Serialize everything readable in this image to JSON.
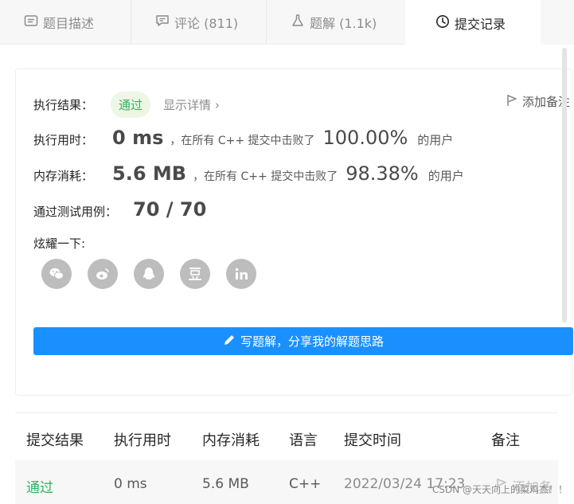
{
  "tabs": [
    {
      "label": "题目描述",
      "icon": "description-icon"
    },
    {
      "label": "评论 (811)",
      "icon": "comment-icon"
    },
    {
      "label": "题解 (1.1k)",
      "icon": "flask-icon"
    },
    {
      "label": "提交记录",
      "icon": "clock-icon",
      "active": true
    }
  ],
  "result": {
    "status_label": "执行结果：",
    "status_value": "通过",
    "details_link": "显示详情",
    "add_note": "添加备注",
    "runtime_label": "执行用时：",
    "runtime_value": "0 ms",
    "runtime_text": "，在所有 C++ 提交中击败了",
    "runtime_percent": "100.00%",
    "runtime_suffix": "的用户",
    "memory_label": "内存消耗：",
    "memory_value": "5.6 MB",
    "memory_text": "，在所有 C++ 提交中击败了",
    "memory_percent": "98.38%",
    "memory_suffix": "的用户",
    "tests_label": "通过测试用例：",
    "tests_value": "70 / 70",
    "share_label": "炫耀一下:",
    "share_icons": [
      "wechat-icon",
      "weibo-icon",
      "qq-icon",
      "douban-icon",
      "linkedin-icon"
    ],
    "write_button": "写题解，分享我的解题思路"
  },
  "table": {
    "headers": [
      "提交结果",
      "执行用时",
      "内存消耗",
      "语言",
      "提交时间",
      "备注"
    ],
    "rows": [
      {
        "result": "通过",
        "runtime": "0 ms",
        "memory": "5.6 MB",
        "language": "C++",
        "time": "2022/03/24 17:23",
        "note": "添加备"
      }
    ]
  },
  "watermark": "CSDN @天天向上的菜鸡杰！！",
  "colors": {
    "accent": "#1a90ff",
    "success": "#2db55d",
    "badge_bg": "#eef6e6"
  }
}
